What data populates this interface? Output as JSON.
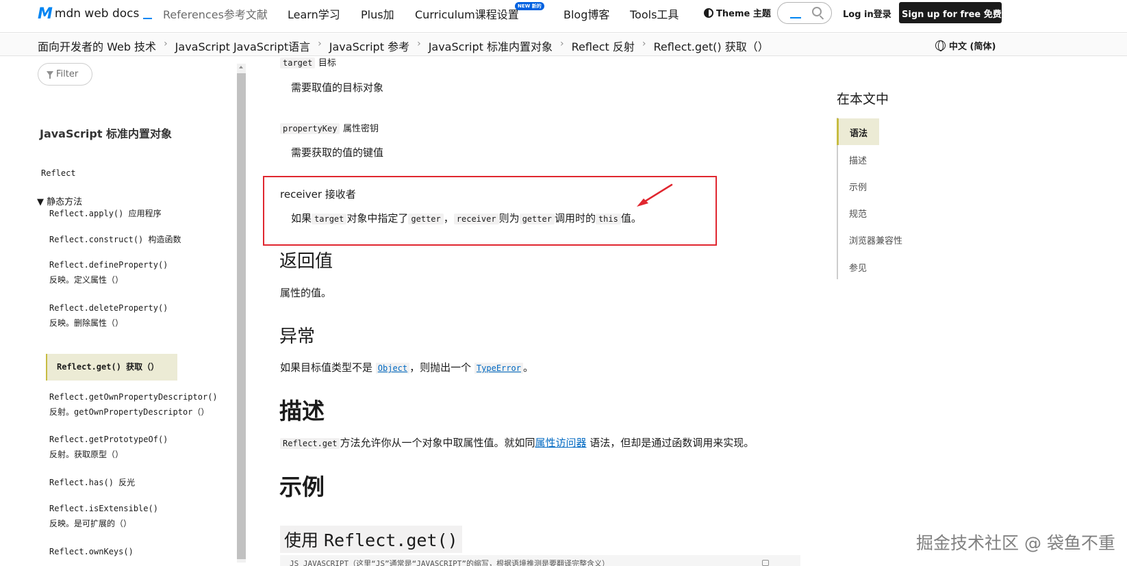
{
  "nav": {
    "logo_text": "mdn web docs",
    "items": [
      {
        "label": "References参考文献"
      },
      {
        "label": "Learn学习"
      },
      {
        "label": "Plus加"
      },
      {
        "label": "Curriculum课程设置"
      },
      {
        "label": "Blog博客"
      },
      {
        "label": "Tools工具"
      }
    ],
    "new_badge": "NEW 新的",
    "theme": "Theme 主题",
    "login": "Log in登录",
    "signup": "Sign up for free 免费注册"
  },
  "breadcrumb": {
    "items": [
      "面向开发者的 Web 技术",
      "JavaScript JavaScript语言",
      "JavaScript 参考",
      "JavaScript 标准内置对象",
      "Reflect 反射",
      "Reflect.get() 获取（）"
    ],
    "separator": "›",
    "language": "中文 (简体)"
  },
  "sidebar": {
    "filter_placeholder": "Filter",
    "title": "JavaScript 标准内置对象",
    "reflect_label": "Reflect",
    "static_methods": "▼ 静态方法",
    "items": [
      {
        "line1": "Reflect.apply() 应用程序",
        "line2": ""
      },
      {
        "line1": "Reflect.construct() 构造函数",
        "line2": ""
      },
      {
        "line1": "Reflect.defineProperty()",
        "line2": "反映。定义属性（）"
      },
      {
        "line1": "Reflect.deleteProperty()",
        "line2": "反映。删除属性（）"
      },
      {
        "line1": "Reflect.get() 获取（）",
        "line2": "",
        "active": true
      },
      {
        "line1": "Reflect.getOwnPropertyDescriptor()",
        "line2": "反射。getOwnPropertyDescriptor（）"
      },
      {
        "line1": "Reflect.getPrototypeOf()",
        "line2": "反射。获取原型（）"
      },
      {
        "line1": "Reflect.has() 反光",
        "line2": ""
      },
      {
        "line1": "Reflect.isExtensible()",
        "line2": "反映。是可扩展的（）"
      },
      {
        "line1": "Reflect.ownKeys()",
        "line2": ""
      }
    ]
  },
  "main": {
    "params": [
      {
        "code": "target",
        "label": "目标",
        "desc": "需要取值的目标对象"
      },
      {
        "code": "propertyKey",
        "label": "属性密钥",
        "desc": "需要获取的值的键值"
      }
    ],
    "receiver": {
      "term": "receiver 接收者",
      "desc_parts": [
        "如果",
        "target",
        "对象中指定了",
        "getter",
        "，",
        "receiver",
        "则为",
        "getter",
        "调用时的",
        "this",
        "值。"
      ]
    },
    "return_heading": "返回值",
    "return_text": "属性的值。",
    "exception_heading": "异常",
    "exception_parts": [
      "如果目标值类型不是 ",
      "Object",
      "，则抛出一个 ",
      "TypeError",
      "。"
    ],
    "description_heading": "描述",
    "description_parts": [
      "Reflect.get",
      "方法允许你从一个对象中取属性值。就如同",
      "属性访问器",
      " 语法，但却是通过函数调用来实现。"
    ],
    "examples_heading": "示例",
    "example_sub_prefix": "使用 ",
    "example_sub_code": "Reflect.get()",
    "codeblock_header": "JS JAVASCRIPT（这里“JS”通常是“JAVASCRIPT”的缩写，根据语境推测是要翻译完整含义）"
  },
  "toc": {
    "title": "在本文中",
    "items": [
      "语法",
      "描述",
      "示例",
      "规范",
      "浏览器兼容性",
      "参见"
    ]
  },
  "watermark": "掘金技术社区 @ 袋鱼不重",
  "colors": {
    "accent": "#0085f2",
    "highlight_bg": "#ecebd5",
    "highlight_border": "#c7bc42",
    "annotation_red": "#e0262f",
    "link": "#0069c2"
  }
}
